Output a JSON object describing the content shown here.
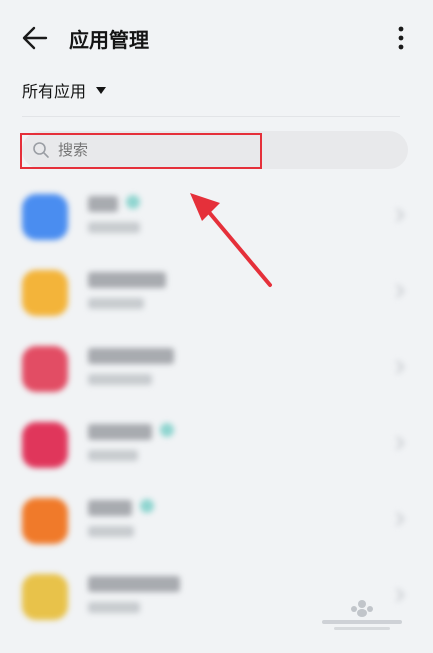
{
  "header": {
    "title": "应用管理",
    "back_icon": "arrow-left-icon",
    "more_icon": "more-vertical-icon"
  },
  "filter": {
    "label": "所有应用",
    "caret_icon": "caret-down-icon"
  },
  "search": {
    "placeholder": "搜索",
    "icon": "search-icon"
  },
  "apps": [
    {
      "icon_color": "#4a8df0",
      "verified": true
    },
    {
      "icon_color": "#f3b43a",
      "verified": false
    },
    {
      "icon_color": "#e24d64",
      "verified": false
    },
    {
      "icon_color": "#e0365b",
      "verified": true
    },
    {
      "icon_color": "#f07a2a",
      "verified": true
    },
    {
      "icon_color": "#e8c24a",
      "verified": false
    }
  ],
  "colors": {
    "background": "#f1f3f5",
    "highlight_border": "#e5303a",
    "annotation_arrow": "#e5303a"
  }
}
